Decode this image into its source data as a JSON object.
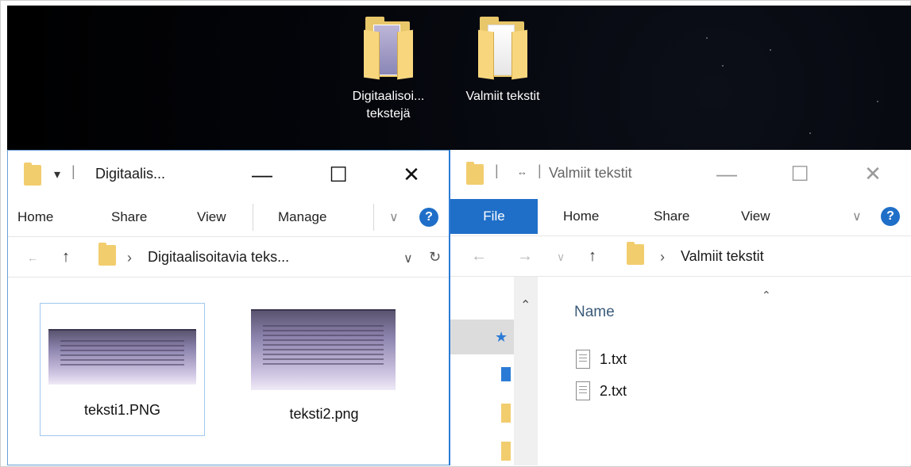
{
  "desktop": {
    "icons": [
      {
        "label_line1": "Digitaalisoi...",
        "label_line2": "tekstejä",
        "icon": "folder-with-images-icon"
      },
      {
        "label_line1": "Valmiit tekstit",
        "label_line2": "",
        "icon": "folder-with-documents-icon"
      }
    ]
  },
  "left_window": {
    "title": "Digitaalis...",
    "quick_access_glyph": "▾",
    "caption": {
      "minimize": "—",
      "maximize": "☐",
      "close": "✕"
    },
    "ribbon": {
      "home": "Home",
      "share": "Share",
      "view": "View",
      "manage": "Manage",
      "expand": "∨",
      "help": "?"
    },
    "address": {
      "back": "←",
      "up": "↑",
      "crumb_chev": "›",
      "path": "Digitaalisoitavia teks...",
      "dropdown": "∨",
      "refresh": "↻"
    },
    "files": [
      {
        "name": "teksti1.PNG",
        "selected": true
      },
      {
        "name": "teksti2.png",
        "selected": false
      }
    ]
  },
  "right_window": {
    "title": "Valmiit tekstit",
    "title_sep": "|",
    "quick_access_glyph": "↔",
    "caption": {
      "minimize": "—",
      "maximize": "☐",
      "close": "✕"
    },
    "ribbon": {
      "file": "File",
      "home": "Home",
      "share": "Share",
      "view": "View",
      "expand": "∨",
      "help": "?"
    },
    "address": {
      "back": "←",
      "forward": "→",
      "recent": "∨",
      "up": "↑",
      "crumb_chev": "›",
      "path": "Valmiit tekstit"
    },
    "nav_pane": {
      "scroll_up": "⌃",
      "pin": "★"
    },
    "list": {
      "column_name": "Name",
      "sort_caret": "⌃",
      "files": [
        "1.txt",
        "2.txt"
      ]
    }
  },
  "colors": {
    "accent": "#1f6fc8",
    "folder": "#f2cd6e",
    "desktop": "#000000"
  }
}
